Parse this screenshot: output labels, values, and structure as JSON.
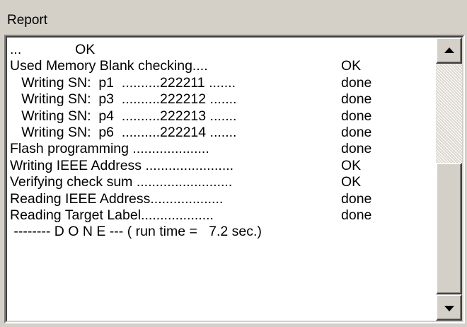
{
  "group_label": "Report",
  "lines": [
    {
      "text": "...              OK",
      "status": ""
    },
    {
      "text": "Used Memory Blank checking....",
      "status": "OK"
    },
    {
      "text": "   Writing SN:  p1  ..........222211 .......",
      "status": "done"
    },
    {
      "text": "   Writing SN:  p3  ..........222212 .......",
      "status": "done"
    },
    {
      "text": "   Writing SN:  p4  ..........222213 .......",
      "status": "done"
    },
    {
      "text": "   Writing SN:  p6  ..........222214 .......",
      "status": "done"
    },
    {
      "text": "Flash programming ....................",
      "status": "done"
    },
    {
      "text": "Writing IEEE Address .......................",
      "status": "OK"
    },
    {
      "text": "Verifying check sum .........................",
      "status": "OK"
    },
    {
      "text": "Reading IEEE Address...................",
      "status": "done"
    },
    {
      "text": "Reading Target Label...................",
      "status": "done"
    },
    {
      "text": " -------- D O N E --- ( run time =   7.2 sec.)",
      "status": ""
    }
  ],
  "icons": {
    "scroll_up": "arrow-up-icon",
    "scroll_down": "arrow-down-icon"
  },
  "colors": {
    "window_bg": "#d4d0c8",
    "text_bg": "#ffffff",
    "text": "#000000"
  }
}
